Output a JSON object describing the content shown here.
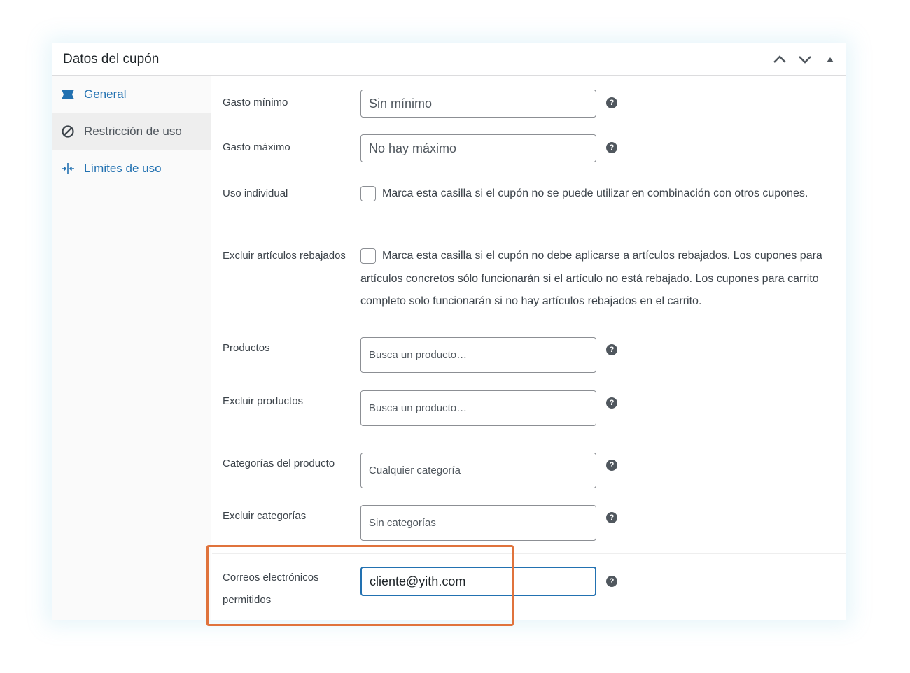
{
  "panel": {
    "title": "Datos del cupón",
    "controls": [
      "chevron-up-icon",
      "chevron-down-icon",
      "triangle-up-icon"
    ]
  },
  "tabs": [
    {
      "label": "General",
      "icon": "ticket-icon",
      "active": false
    },
    {
      "label": "Restricción de uso",
      "icon": "prohibited-icon",
      "active": true
    },
    {
      "label": "Límites de uso",
      "icon": "limits-icon",
      "active": false
    }
  ],
  "fields": {
    "min_spend": {
      "label": "Gasto mínimo",
      "placeholder": "Sin mínimo"
    },
    "max_spend": {
      "label": "Gasto máximo",
      "placeholder": "No hay máximo"
    },
    "individual_use": {
      "label": "Uso individual",
      "description": "Marca esta casilla si el cupón no se puede utilizar en combinación con otros cupones.",
      "checked": false
    },
    "exclude_sale": {
      "label": "Excluir artículos rebajados",
      "description": "Marca esta casilla si el cupón no debe aplicarse a artículos rebajados. Los cupones para artículos concretos sólo funcionarán si el artículo no está rebajado. Los cupones para carrito completo solo funcionarán si no hay artículos rebajados en el carrito.",
      "checked": false
    },
    "products": {
      "label": "Productos",
      "placeholder": "Busca un producto…"
    },
    "exclude_products": {
      "label": "Excluir productos",
      "placeholder": "Busca un producto…"
    },
    "categories": {
      "label": "Categorías del producto",
      "placeholder": "Cualquier categoría"
    },
    "exclude_categories": {
      "label": "Excluir categorías",
      "placeholder": "Sin categorías"
    },
    "allowed_emails": {
      "label": "Correos electrónicos permitidos",
      "value": "cliente@yith.com"
    }
  },
  "help_glyph": "?",
  "colors": {
    "link": "#2271b1",
    "highlight": "#e0733c",
    "focus": "#2271b1"
  }
}
